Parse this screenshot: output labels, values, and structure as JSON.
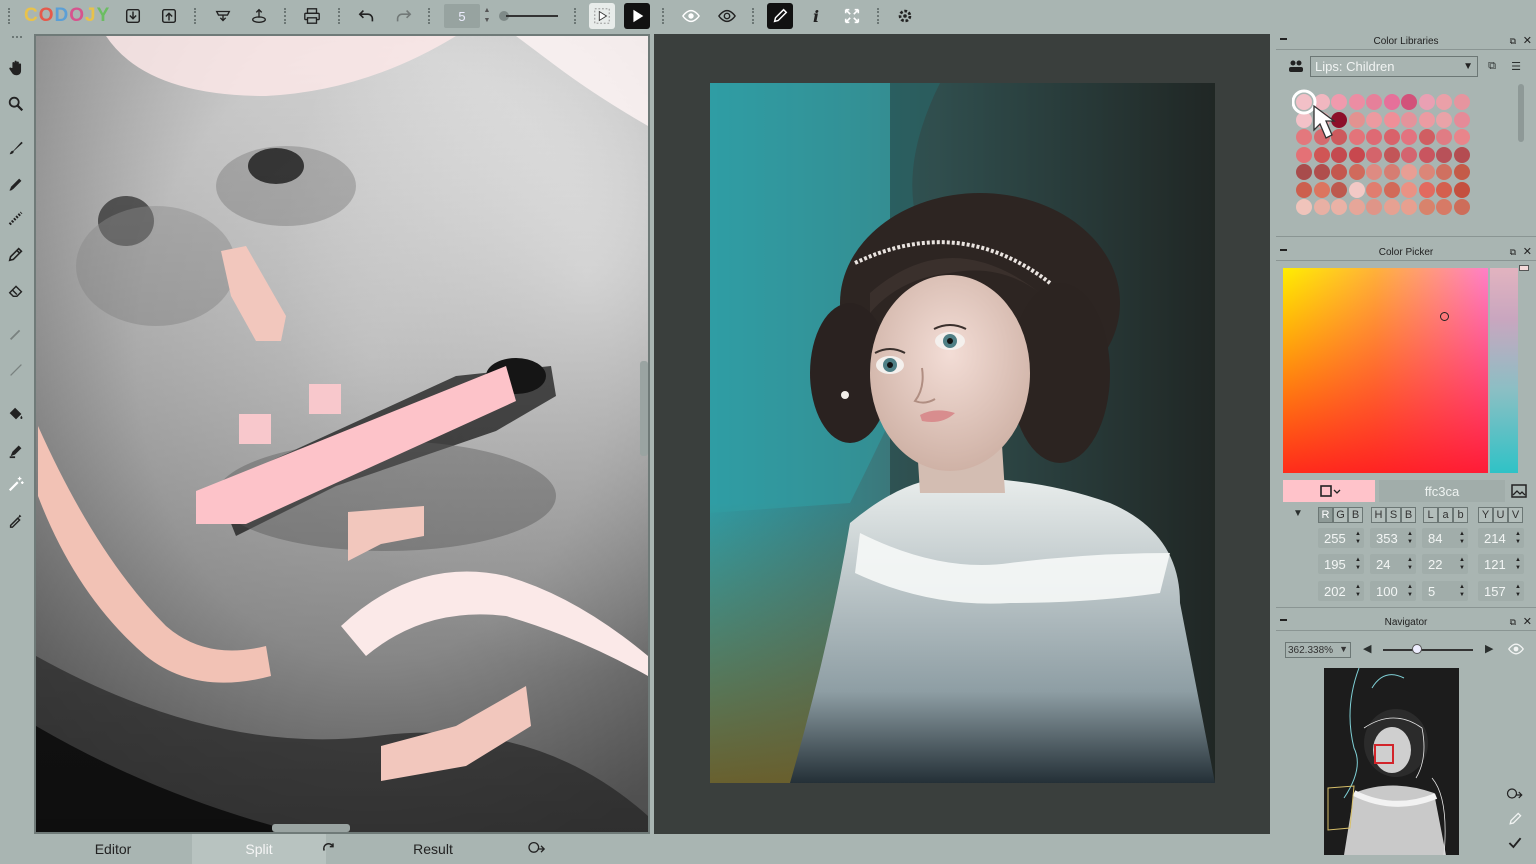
{
  "app": {
    "logo_letters": [
      "C",
      "O",
      "D",
      "O",
      "J",
      "Y"
    ],
    "logo_colors": [
      "#e8c24b",
      "#e55a4b",
      "#5b9fd6",
      "#d6548e",
      "#e8c24b",
      "#6bbd62"
    ]
  },
  "toolbar": {
    "brush_size": "5",
    "icons": [
      "import-icon",
      "export-icon",
      "save-mask-icon",
      "load-mask-icon",
      "print-icon",
      "undo-icon",
      "redo-icon",
      "preview-icon",
      "play-icon",
      "eye-icon",
      "eye-mask-icon",
      "pencil-icon",
      "info-icon",
      "fullscreen-icon",
      "settings-icon"
    ]
  },
  "tabs": {
    "editor": "Editor",
    "split": "Split",
    "result": "Result"
  },
  "color_libraries": {
    "title": "Color Libraries",
    "selected_library": "Lips: Children",
    "swatch_colors": [
      [
        "#f2c0c7",
        "#f1b7c0",
        "#f09aad",
        "#ec8da3",
        "#e6809a",
        "#e6709a",
        "#d2527a",
        "#e9a0b3",
        "#eaa0a8",
        "#e6959f"
      ],
      [
        "#f3c2c8",
        "#e9a9ae",
        "#8c0f2a",
        "#e39290",
        "#ec9aa0",
        "#ef8f98",
        "#e4939b",
        "#eb9ba2",
        "#e9a3a8",
        "#e58b98"
      ],
      [
        "#e3787d",
        "#d76a6e",
        "#cd5a5d",
        "#e3747a",
        "#de6a74",
        "#d9626a",
        "#e3737f",
        "#d05e62",
        "#e07c84",
        "#e9858b"
      ],
      [
        "#e47176",
        "#d05555",
        "#c44a4f",
        "#c8484e",
        "#d4646b",
        "#c25558",
        "#d4646f",
        "#c9555f",
        "#b85159",
        "#b44c51"
      ],
      [
        "#a84c4c",
        "#b04e4c",
        "#c4574e",
        "#d06a5c",
        "#de8b82",
        "#d67d72",
        "#e89e94",
        "#db8678",
        "#d07060",
        "#c45b48"
      ],
      [
        "#cc5f4e",
        "#dc755f",
        "#bd594e",
        "#f2c9c6",
        "#e07d6f",
        "#d26a58",
        "#ea9284",
        "#e26a5f",
        "#d45f4e",
        "#c4503f"
      ],
      [
        "#f0c4bb",
        "#e8b0a4",
        "#eab2a6",
        "#e6a699",
        "#df9588",
        "#e6a192",
        "#e7a090",
        "#d8836c",
        "#d77a66",
        "#cd6d5a"
      ]
    ]
  },
  "color_picker": {
    "title": "Color Picker",
    "hex": "ffc3ca",
    "current_color": "#ffc3ca",
    "modes": {
      "rgb": [
        "R",
        "G",
        "B"
      ],
      "hsb": [
        "H",
        "S",
        "B"
      ],
      "lab": [
        "L",
        "a",
        "b"
      ],
      "yuv": [
        "Y",
        "U",
        "V"
      ]
    },
    "values": {
      "rgb": [
        "255",
        "195",
        "202"
      ],
      "hsb": [
        "353",
        "24",
        "100"
      ],
      "lab": [
        "84",
        "22",
        "5"
      ],
      "yuv": [
        "214",
        "121",
        "157"
      ]
    }
  },
  "navigator": {
    "title": "Navigator",
    "zoom": "362.338%",
    "zoom_slider_fraction": 0.38
  }
}
